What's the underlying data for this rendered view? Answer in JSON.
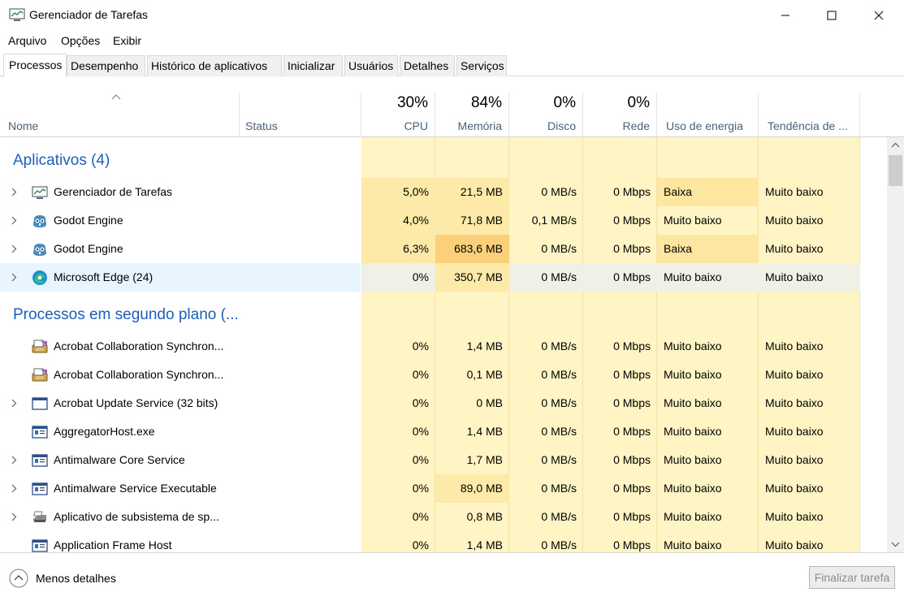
{
  "window": {
    "title": "Gerenciador de Tarefas",
    "minimize": "minimize-icon",
    "maximize": "maximize-icon",
    "close": "close-icon"
  },
  "menu": [
    "Arquivo",
    "Opções",
    "Exibir"
  ],
  "tabs": [
    "Processos",
    "Desempenho",
    "Histórico de aplicativos",
    "Inicializar",
    "Usuários",
    "Detalhes",
    "Serviços"
  ],
  "active_tab": "Processos",
  "columns": {
    "name": "Nome",
    "status": "Status",
    "cpu": {
      "label": "CPU",
      "pct": "30%"
    },
    "memory": {
      "label": "Memória",
      "pct": "84%"
    },
    "disk": {
      "label": "Disco",
      "pct": "0%"
    },
    "network": {
      "label": "Rede",
      "pct": "0%"
    },
    "power": "Uso de energia",
    "trend": "Tendência de ..."
  },
  "groups": {
    "apps": "Aplicativos (4)",
    "background": "Processos em segundo plano (..."
  },
  "apps": [
    {
      "name": "Gerenciador de Tarefas",
      "cpu": "5,0%",
      "mem": "21,5 MB",
      "disk": "0 MB/s",
      "net": "0 Mbps",
      "power": "Baixa",
      "trend": "Muito baixo",
      "icon": "task-manager-icon",
      "expand": true
    },
    {
      "name": "Godot Engine",
      "cpu": "4,0%",
      "mem": "71,8 MB",
      "disk": "0,1 MB/s",
      "net": "0 Mbps",
      "power": "Muito baixo",
      "trend": "Muito baixo",
      "icon": "godot-icon",
      "expand": true
    },
    {
      "name": "Godot Engine",
      "cpu": "6,3%",
      "mem": "683,6 MB",
      "disk": "0 MB/s",
      "net": "0 Mbps",
      "power": "Baixa",
      "trend": "Muito baixo",
      "icon": "godot-icon",
      "expand": true
    },
    {
      "name": "Microsoft Edge (24)",
      "cpu": "0%",
      "mem": "350,7 MB",
      "disk": "0 MB/s",
      "net": "0 Mbps",
      "power": "Muito baixo",
      "trend": "Muito baixo",
      "icon": "edge-icon",
      "expand": true
    }
  ],
  "background": [
    {
      "name": "Acrobat Collaboration Synchron...",
      "cpu": "0%",
      "mem": "1,4 MB",
      "disk": "0 MB/s",
      "net": "0 Mbps",
      "power": "Muito baixo",
      "trend": "Muito baixo",
      "icon": "acrobat-sync-icon",
      "expand": false
    },
    {
      "name": "Acrobat Collaboration Synchron...",
      "cpu": "0%",
      "mem": "0,1 MB",
      "disk": "0 MB/s",
      "net": "0 Mbps",
      "power": "Muito baixo",
      "trend": "Muito baixo",
      "icon": "acrobat-sync-icon",
      "expand": false
    },
    {
      "name": "Acrobat Update Service (32 bits)",
      "cpu": "0%",
      "mem": "0 MB",
      "disk": "0 MB/s",
      "net": "0 Mbps",
      "power": "Muito baixo",
      "trend": "Muito baixo",
      "icon": "service-window-icon",
      "expand": true
    },
    {
      "name": "AggregatorHost.exe",
      "cpu": "0%",
      "mem": "1,4 MB",
      "disk": "0 MB/s",
      "net": "0 Mbps",
      "power": "Muito baixo",
      "trend": "Muito baixo",
      "icon": "process-icon",
      "expand": false
    },
    {
      "name": "Antimalware Core Service",
      "cpu": "0%",
      "mem": "1,7 MB",
      "disk": "0 MB/s",
      "net": "0 Mbps",
      "power": "Muito baixo",
      "trend": "Muito baixo",
      "icon": "process-icon",
      "expand": true
    },
    {
      "name": "Antimalware Service Executable",
      "cpu": "0%",
      "mem": "89,0 MB",
      "disk": "0 MB/s",
      "net": "0 Mbps",
      "power": "Muito baixo",
      "trend": "Muito baixo",
      "icon": "process-icon",
      "expand": true
    },
    {
      "name": "Aplicativo de subsistema de sp...",
      "cpu": "0%",
      "mem": "0,8 MB",
      "disk": "0 MB/s",
      "net": "0 Mbps",
      "power": "Muito baixo",
      "trend": "Muito baixo",
      "icon": "printer-icon",
      "expand": true
    },
    {
      "name": "Application Frame Host",
      "cpu": "0%",
      "mem": "1,4 MB",
      "disk": "0 MB/s",
      "net": "0 Mbps",
      "power": "Muito baixo",
      "trend": "Muito baixo",
      "icon": "process-icon",
      "expand": false
    }
  ],
  "footer": {
    "less_details": "Menos detalhes",
    "end_task": "Finalizar tarefa"
  }
}
